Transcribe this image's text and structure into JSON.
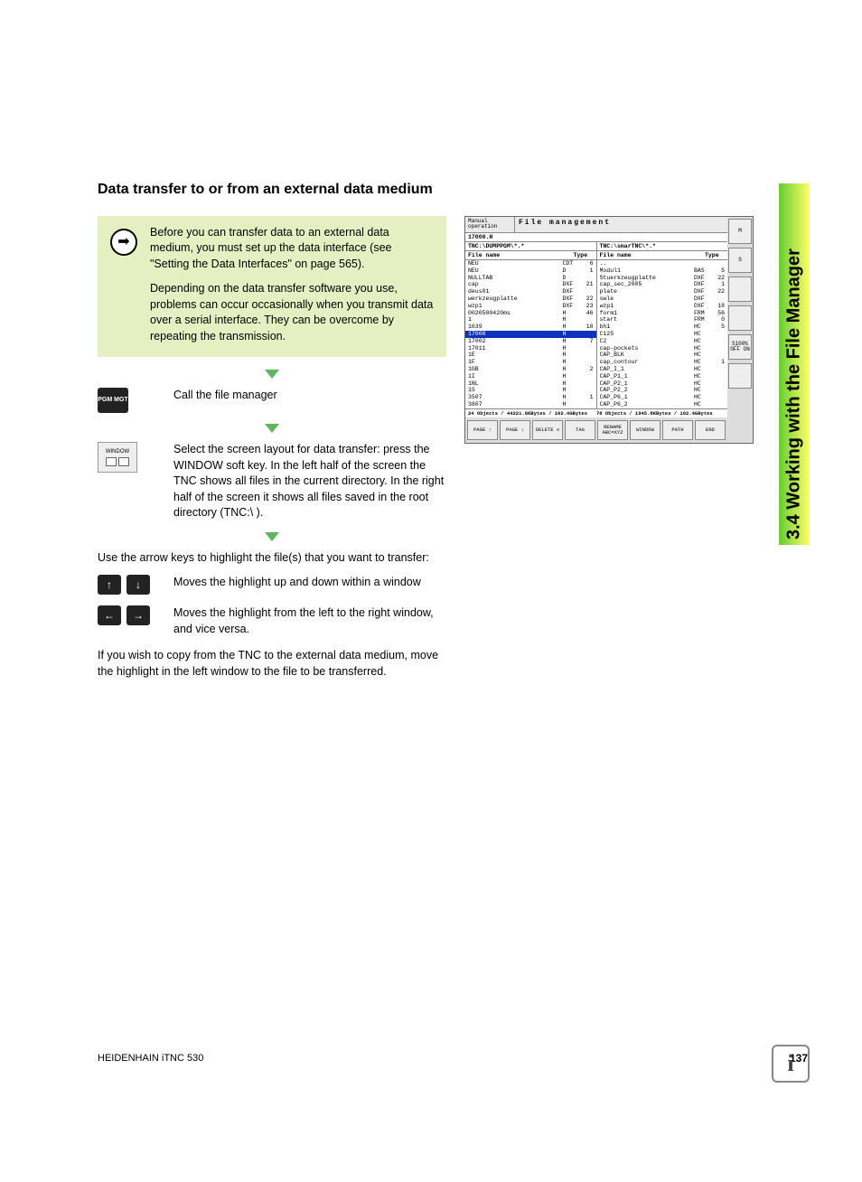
{
  "heading": "Data transfer to or from an external data medium",
  "note": {
    "p1": "Before you can transfer data to an external data medium, you must set up the data interface (see \"Setting the Data Interfaces\" on page 565).",
    "p2": "Depending on the data transfer software you use, problems can occur occasionally when you transmit data over a serial interface. They can be overcome by repeating the transmission."
  },
  "steps": {
    "pgmmgt_label": "PGM\nMGT",
    "s1": "Call the file manager",
    "window_sk_label": "WINDOW",
    "s2": "Select the screen layout for data transfer: press the WINDOW soft key. In the left half of the screen the TNC shows all files in the current directory. In the right half of the screen it shows all files saved in the root directory (TNC:\\ )."
  },
  "body": {
    "p_intro2": "Use the arrow keys to highlight the file(s) that you want to transfer:",
    "arrow_updown": "Moves the highlight up and down within a window",
    "arrow_leftright": "Moves the highlight from the left to the right window, and vice versa.",
    "p_copy": "If you wish to copy from the TNC to the external data medium, move the highlight in the left window to the file to be transferred."
  },
  "screenshot": {
    "mode_line1": "Manual",
    "mode_line2": "operation",
    "title": "File management",
    "file_path": "17000.H",
    "left_path": "TNC:\\DUMPPGM\\*.*",
    "right_path": "TNC:\\smarTNC\\*.*",
    "col_file": "File name",
    "col_type": "Type",
    "left_rows": [
      {
        "n": "NEU",
        "t": "CDT",
        "s": "6"
      },
      {
        "n": "NEU",
        "t": "D",
        "s": "1"
      },
      {
        "n": "NULLTAB",
        "t": "D",
        "s": ""
      },
      {
        "n": "cap",
        "t": "DXF",
        "s": "21"
      },
      {
        "n": "deus01",
        "t": "DXF",
        "s": ""
      },
      {
        "n": "werkzeugplatte",
        "t": "DXF",
        "s": "22"
      },
      {
        "n": "wzp1",
        "t": "DXF",
        "s": "23"
      },
      {
        "n": "0020500420ms",
        "t": "H",
        "s": "46"
      },
      {
        "n": "1",
        "t": "H",
        "s": ""
      },
      {
        "n": "1639",
        "t": "H",
        "s": "10"
      },
      {
        "n": "17000",
        "t": "H",
        "s": "",
        "sel": true
      },
      {
        "n": "17002",
        "t": "H",
        "s": "7"
      },
      {
        "n": "17011",
        "t": "H",
        "s": ""
      },
      {
        "n": "1E",
        "t": "H",
        "s": ""
      },
      {
        "n": "1F",
        "t": "H",
        "s": ""
      },
      {
        "n": "1GB",
        "t": "H",
        "s": "2"
      },
      {
        "n": "1I",
        "t": "H",
        "s": ""
      },
      {
        "n": "1NL",
        "t": "H",
        "s": ""
      },
      {
        "n": "1S",
        "t": "H",
        "s": ""
      },
      {
        "n": "3507",
        "t": "H",
        "s": "1"
      },
      {
        "n": "3807",
        "t": "H",
        "s": ""
      }
    ],
    "right_rows": [
      {
        "n": "..",
        "t": "",
        "s": ""
      },
      {
        "n": "Modul1",
        "t": "BAS",
        "s": "5"
      },
      {
        "n": "Stuerkzeugplatte",
        "t": "DXF",
        "s": "22"
      },
      {
        "n": "cap_sec_2005",
        "t": "DXF",
        "s": "1"
      },
      {
        "n": "plate",
        "t": "DXF",
        "s": "22"
      },
      {
        "n": "swle",
        "t": "DXF",
        "s": ""
      },
      {
        "n": "wzp1",
        "t": "DXF",
        "s": "18"
      },
      {
        "n": "form1",
        "t": "FRM",
        "s": "56"
      },
      {
        "n": "start",
        "t": "FRM",
        "s": "0"
      },
      {
        "n": "bh1",
        "t": "HC",
        "s": "5"
      },
      {
        "n": "C125",
        "t": "HC",
        "s": ""
      },
      {
        "n": "C2",
        "t": "HC",
        "s": ""
      },
      {
        "n": "cap-pockets",
        "t": "HC",
        "s": ""
      },
      {
        "n": "CAP_BLK",
        "t": "HC",
        "s": ""
      },
      {
        "n": "cap_contour",
        "t": "HC",
        "s": "1"
      },
      {
        "n": "CAP_I_1",
        "t": "HC",
        "s": ""
      },
      {
        "n": "CAP_P1_1",
        "t": "HC",
        "s": ""
      },
      {
        "n": "CAP_P2_1",
        "t": "HC",
        "s": ""
      },
      {
        "n": "CAP_P2_2",
        "t": "HC",
        "s": ""
      },
      {
        "n": "CAP_P6_1",
        "t": "HC",
        "s": ""
      },
      {
        "n": "CAP_P6_2",
        "t": "HC",
        "s": ""
      }
    ],
    "status_left": "24 Objects / 44221.6KBytes / 102.4GBytes",
    "status_right": "78 Objects / 1945.8KBytes / 102.4GBytes",
    "softkeys": [
      "PAGE\n↑",
      "PAGE\n↓",
      "DELETE\n✕",
      "TAG",
      "RENAME\nABC=XYZ",
      "WINDOW",
      "PATH",
      "END"
    ],
    "side_buttons": [
      "M",
      "S",
      "",
      "",
      "S100%\nOFF ON",
      ""
    ]
  },
  "side_tab": "3.4 Working with the File Manager",
  "footer": {
    "left": "HEIDENHAIN iTNC 530",
    "page": "137"
  },
  "info_glyph": "i"
}
